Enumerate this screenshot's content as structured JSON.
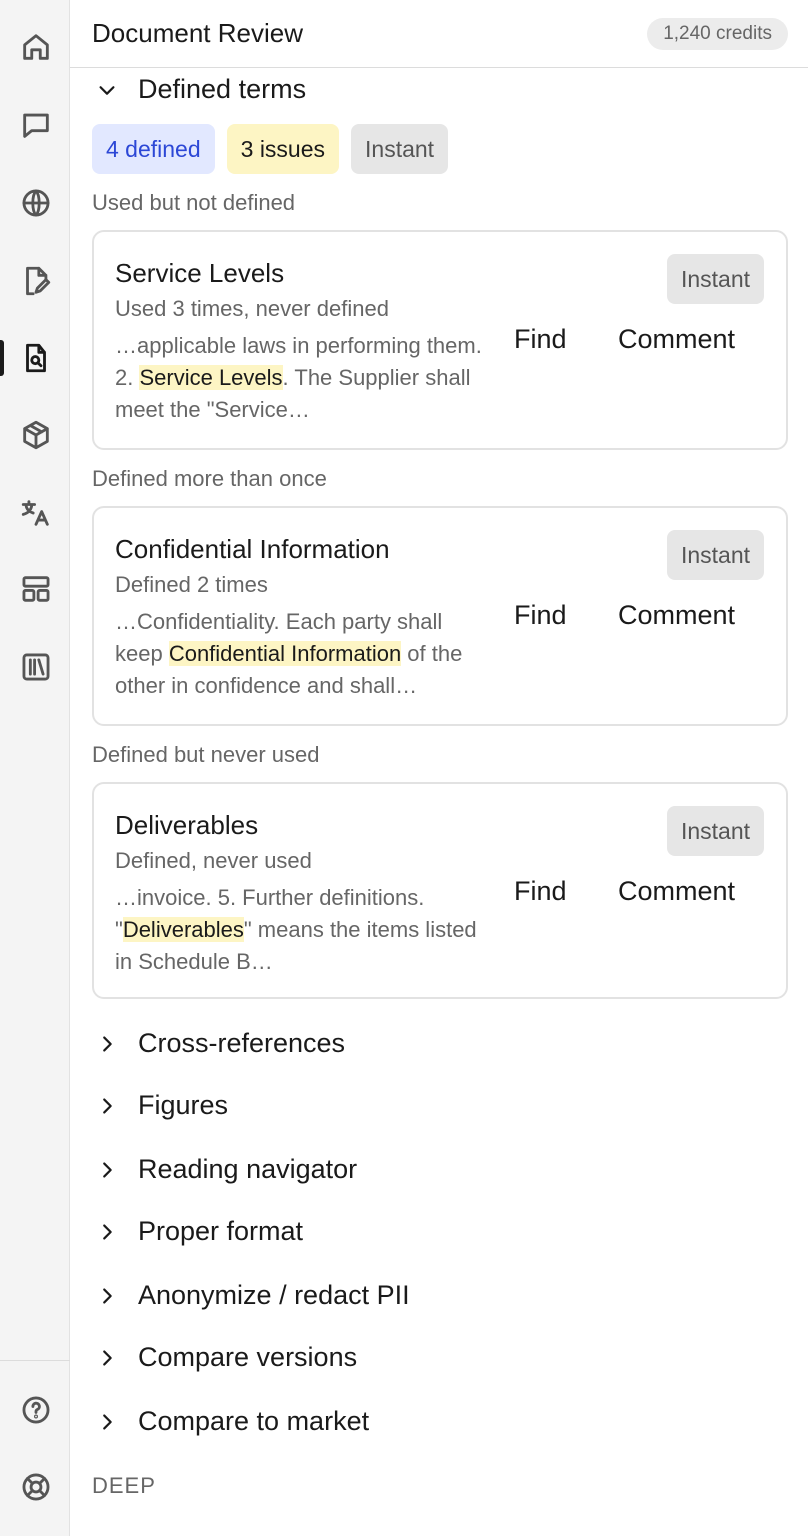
{
  "header": {
    "title": "Document Review",
    "credits": "1,240 credits"
  },
  "rail": {
    "items": [
      {
        "icon": "home-icon"
      },
      {
        "icon": "chat-icon"
      },
      {
        "icon": "globe-icon"
      },
      {
        "icon": "file-edit-icon"
      },
      {
        "icon": "document-search-icon",
        "active": true
      },
      {
        "icon": "box-icon"
      },
      {
        "icon": "translate-icon"
      },
      {
        "icon": "layout-icon"
      },
      {
        "icon": "library-icon"
      }
    ],
    "bottom": [
      {
        "icon": "help-icon"
      },
      {
        "icon": "lifebuoy-icon"
      }
    ]
  },
  "defined_terms": {
    "heading": "Defined terms",
    "badges": {
      "defined": "4 defined",
      "issues": "3 issues",
      "instant": "Instant"
    },
    "groups": [
      {
        "label": "Used but not defined",
        "card": {
          "title": "Service Levels",
          "meta": "Used 3 times, never defined",
          "snippet_before": "…applicable laws in performing them. 2. ",
          "snippet_highlight": "Service Levels",
          "snippet_after": ". The Supplier shall meet the \"Service…",
          "badge": "Instant",
          "find": "Find",
          "comment": "Comment"
        }
      },
      {
        "label": "Defined more than once",
        "card": {
          "title": "Confidential Information",
          "meta": "Defined 2 times",
          "snippet_before": "…Confidentiality. Each party shall keep ",
          "snippet_highlight": "Confidential Information",
          "snippet_after": " of the other in confidence and shall…",
          "badge": "Instant",
          "find": "Find",
          "comment": "Comment"
        }
      },
      {
        "label": "Defined but never used",
        "card": {
          "title": "Deliverables",
          "meta": "Defined, never used",
          "snippet_before": "…invoice. 5. Further definitions. \"",
          "snippet_highlight": "Deliverables",
          "snippet_after": "\" means the items listed in Schedule B…",
          "badge": "Instant",
          "find": "Find",
          "comment": "Comment"
        }
      }
    ]
  },
  "sections": [
    "Cross-references",
    "Figures",
    "Reading navigator",
    "Proper format",
    "Anonymize / redact PII",
    "Compare versions",
    "Compare to market"
  ],
  "deep_label": "DEEP"
}
